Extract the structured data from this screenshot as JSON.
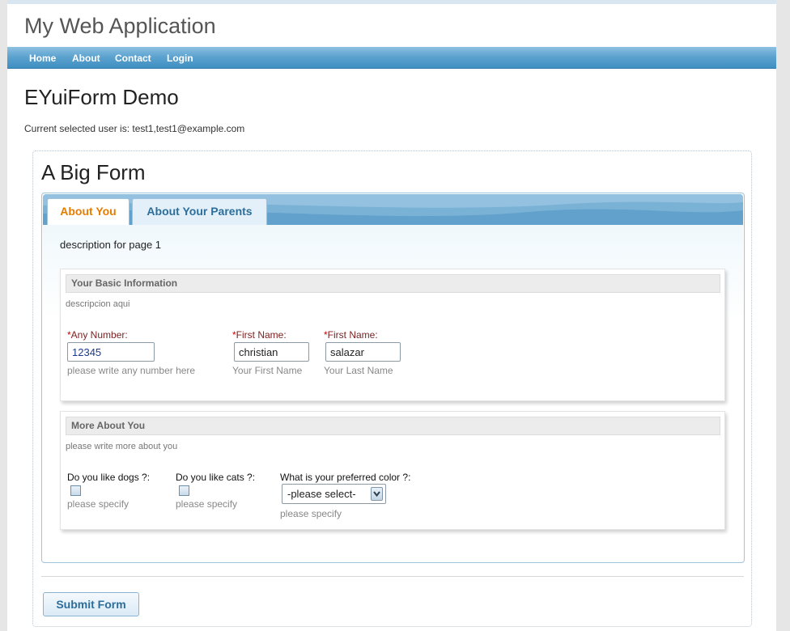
{
  "app": {
    "title": "My Web Application"
  },
  "nav": {
    "items": [
      "Home",
      "About",
      "Contact",
      "Login"
    ]
  },
  "page": {
    "heading": "EYuiForm Demo",
    "selected_user": "Current selected user is: test1,test1@example.com"
  },
  "form": {
    "title": "A Big Form",
    "tabs": [
      {
        "label": "About You",
        "active": true
      },
      {
        "label": "About Your Parents",
        "active": false
      }
    ],
    "page_description": "description for page 1",
    "sections": {
      "basic": {
        "title": "Your Basic Information",
        "description": "descripcion aqui",
        "fields": [
          {
            "label": "Any Number:",
            "required": true,
            "value": "12345",
            "hint": "please write any number here"
          },
          {
            "label": "First Name:",
            "required": true,
            "value": "christian",
            "hint": "Your First Name"
          },
          {
            "label": "First Name:",
            "required": true,
            "value": "salazar",
            "hint": "Your Last Name"
          }
        ]
      },
      "more": {
        "title": "More About You",
        "description": "please write more about you",
        "fields": [
          {
            "label": "Do you like dogs ?:",
            "type": "checkbox",
            "checked": false,
            "hint": "please specify"
          },
          {
            "label": "Do you like cats ?:",
            "type": "checkbox",
            "checked": false,
            "hint": "please specify"
          },
          {
            "label": "What is your preferred color ?:",
            "type": "select",
            "selected": "-please select-",
            "hint": "please specify"
          }
        ]
      }
    },
    "submit_label": "Submit Form"
  },
  "colors": {
    "nav_bar": "#5da3cf",
    "active_tab_text": "#e67c00",
    "inactive_tab_text": "#2c6e9b",
    "required_label": "#7a1f1f"
  }
}
